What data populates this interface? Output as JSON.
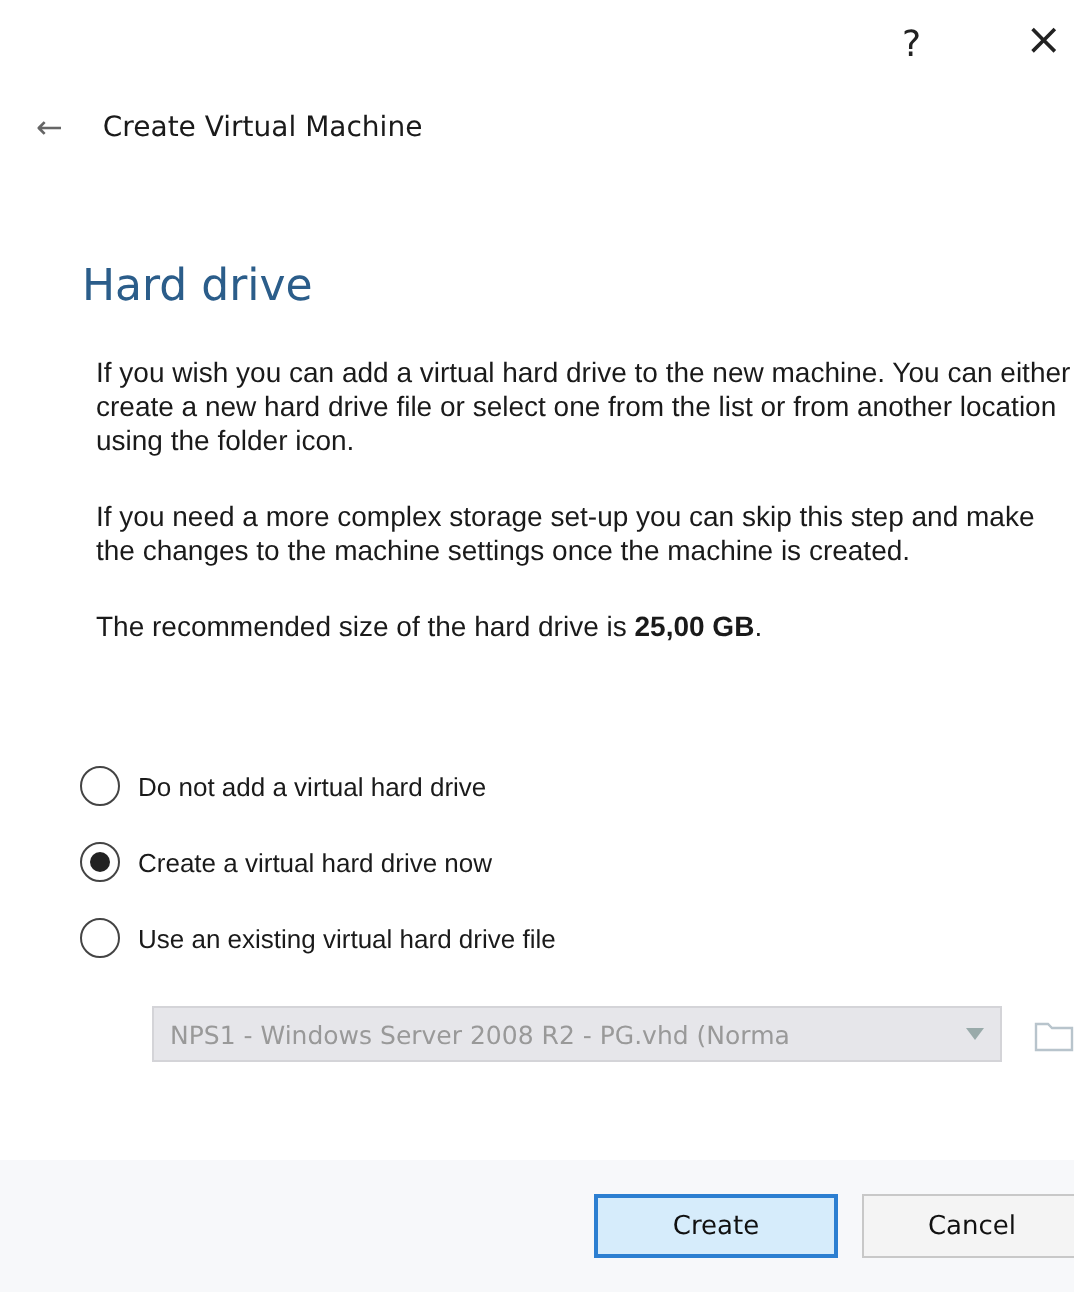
{
  "title_bar": {
    "help": "?",
    "close": "×"
  },
  "header": {
    "back": "←",
    "title": "Create Virtual Machine"
  },
  "page_title": "Hard drive",
  "paragraphs": [
    "If you wish you can add a virtual hard drive to the new machine. You can either create a new hard drive file or select one from the list or from another location using the folder icon.",
    "If you need a more complex storage set-up you can skip this step and make the changes to the machine settings once the machine is created.",
    "The recommended size of the hard drive is **25,00 GB**."
  ],
  "options": [
    {
      "label": "Do not add a virtual hard drive",
      "selected": false
    },
    {
      "label": "Create a virtual hard drive now",
      "selected": true
    },
    {
      "label": "Use an existing virtual hard drive file",
      "selected": false
    }
  ],
  "file_combo": {
    "value": "NPS1 - Windows Server 2008 R2 - PG.vhd (Norma",
    "disabled": true
  },
  "buttons": [
    {
      "label": "Create",
      "default": true
    },
    {
      "label": "Cancel",
      "default": false
    }
  ]
}
